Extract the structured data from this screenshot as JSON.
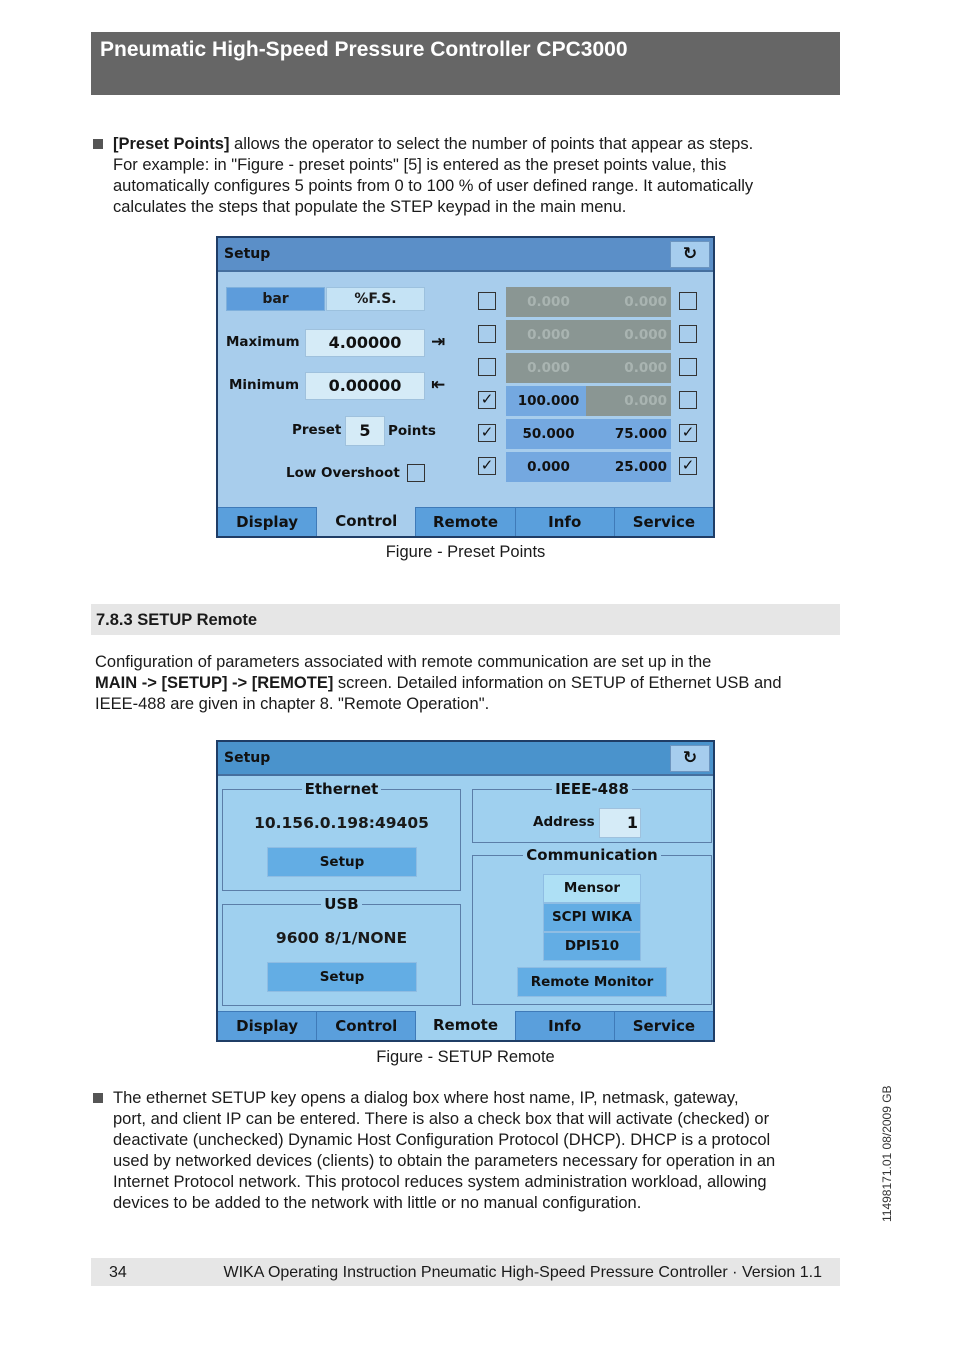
{
  "header": {
    "title": "Pneumatic High-Speed Pressure Controller CPC3000"
  },
  "intro": {
    "bold": "[Preset Points]",
    "lines": [
      " allows the operator to select the number of points that appear as steps.",
      "For example: in \"Figure - preset points\" [5] is entered as the preset points value, this",
      "automatically configures 5 points from 0 to 100 % of user defined range. It automatically",
      "calculates the steps that populate the STEP keypad in the main menu."
    ]
  },
  "fig1": {
    "title": "Setup",
    "refresh_icon": "↻",
    "unit_bar": "bar",
    "unit_fs": "%F.S.",
    "max_label": "Maximum",
    "max_value": "4.00000",
    "max_icon": "⇥",
    "min_label": "Minimum",
    "min_value": "0.00000",
    "min_icon": "⇤",
    "preset_label": "Preset",
    "preset_value": "5",
    "points_label": "Points",
    "overshoot_label": "Low Overshoot",
    "rows": [
      {
        "lchk": false,
        "lval": "0.000",
        "lon": false,
        "rval": "0.000",
        "ron": false,
        "rchk": false
      },
      {
        "lchk": false,
        "lval": "0.000",
        "lon": false,
        "rval": "0.000",
        "ron": false,
        "rchk": false
      },
      {
        "lchk": false,
        "lval": "0.000",
        "lon": false,
        "rval": "0.000",
        "ron": false,
        "rchk": false
      },
      {
        "lchk": true,
        "lval": "100.000",
        "lon": true,
        "rval": "0.000",
        "ron": false,
        "rchk": false
      },
      {
        "lchk": true,
        "lval": "50.000",
        "lon": true,
        "rval": "75.000",
        "ron": true,
        "rchk": true
      },
      {
        "lchk": true,
        "lval": "0.000",
        "lon": true,
        "rval": "25.000",
        "ron": true,
        "rchk": true
      }
    ],
    "tabs": [
      "Display",
      "Control",
      "Remote",
      "Info",
      "Service"
    ],
    "active_tab": "Control",
    "caption": "Figure - Preset Points"
  },
  "section": {
    "title": "7.8.3 SETUP Remote"
  },
  "remote_para": {
    "line1": "Configuration of parameters associated with remote communication are set up in the",
    "bold": "MAIN -> [SETUP] -> [REMOTE]",
    "line2_rest": " screen. Detailed information on SETUP of Ethernet USB and",
    "line3": "IEEE-488 are given in chapter 8. \"Remote Operation\"."
  },
  "fig2": {
    "title": "Setup",
    "refresh_icon": "↻",
    "ethernet": {
      "label": "Ethernet",
      "value": "10.156.0.198:49405",
      "button": "Setup"
    },
    "usb": {
      "label": "USB",
      "value": "9600 8/1/NONE",
      "button": "Setup"
    },
    "ieee": {
      "label": "IEEE-488",
      "address_label": "Address",
      "address_value": "1"
    },
    "communication": {
      "label": "Communication",
      "options": [
        "Mensor",
        "SCPI WIKA",
        "DPI510"
      ],
      "selected": "Mensor",
      "monitor_button": "Remote Monitor"
    },
    "tabs": [
      "Display",
      "Control",
      "Remote",
      "Info",
      "Service"
    ],
    "active_tab": "Remote",
    "caption": "Figure - SETUP Remote"
  },
  "ethernet_para": {
    "lines": [
      "The ethernet SETUP key opens a dialog box where host name, IP, netmask, gateway,",
      "port, and client IP can be entered. There is also a check box that will activate (checked) or",
      "deactivate (unchecked) Dynamic Host Configuration Protocol (DHCP). DHCP is a protocol",
      "used by networked devices (clients) to obtain the parameters necessary for operation in an",
      "Internet Protocol network. This protocol reduces system administration workload, allowing",
      "devices to be added to the network with little or no manual configuration."
    ]
  },
  "footer": {
    "page": "34",
    "text": "WIKA Operating Instruction Pneumatic High-Speed Pressure Controller · Version 1.1"
  },
  "side_code": "11498171.01 08/2009  GB"
}
